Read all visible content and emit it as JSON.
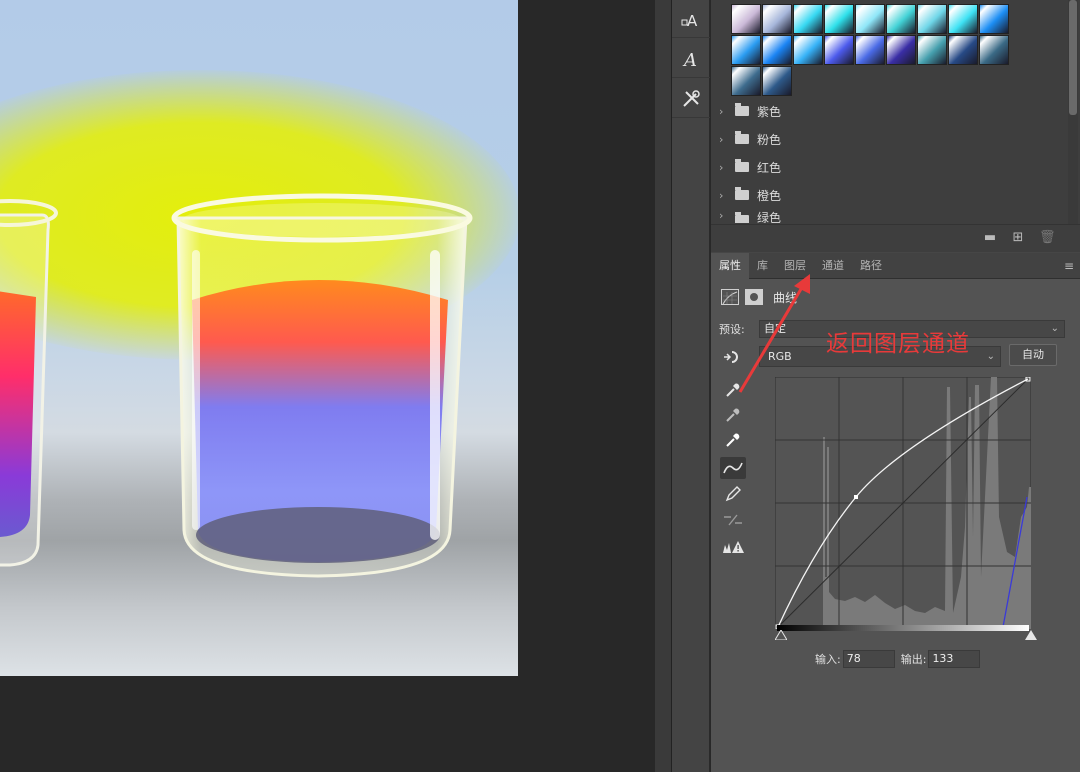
{
  "toolstrip": {
    "icons": [
      "type-on-path-icon",
      "character-icon",
      "tools-icon"
    ]
  },
  "swatches": {
    "colors": [
      "#cbb9d8",
      "#a6b6da",
      "#36d8f2",
      "#2ee0ea",
      "#8ee6f8",
      "#42d2d6",
      "#6ed6e8",
      "#3ee2f4",
      "#1c8ef4",
      "#2a9cf2",
      "#1a84f4",
      "#36b2f8",
      "#4c5aec",
      "#4a6ae6",
      "#3a2ea6",
      "#46a0ae",
      "#274a86",
      "#3a6a86",
      "#3e6c8e",
      "#2e5a8a"
    ],
    "folders": [
      "紫色",
      "粉色",
      "红色",
      "橙色",
      "绿色"
    ]
  },
  "properties": {
    "tabs": [
      "属性",
      "库",
      "图层",
      "通道",
      "路径"
    ],
    "active_tab": "属性",
    "adjustment_title": "曲线",
    "preset_label": "预设:",
    "preset_value": "自定",
    "channel_value": "RGB",
    "auto_label": "自动",
    "input_label": "输入:",
    "input_value": "78",
    "output_label": "输出:",
    "output_value": "133"
  },
  "annotation": {
    "text": "返回图层通道",
    "color": "#e83a3a"
  },
  "colors": {
    "panel_bg": "#535353",
    "canvas_bg": "#282828",
    "glow": "#e6f000"
  }
}
